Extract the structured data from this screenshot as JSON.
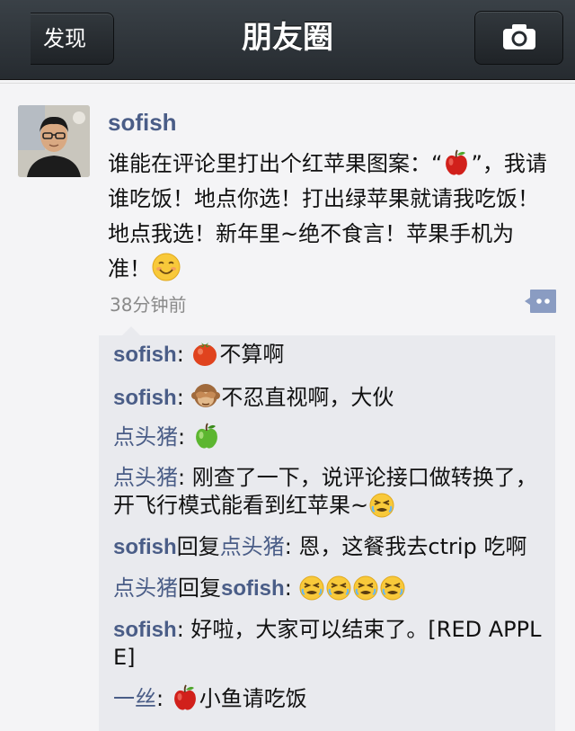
{
  "nav": {
    "back_label": "发现",
    "title": "朋友圈",
    "camera_icon": "camera-icon"
  },
  "post": {
    "author": "sofish",
    "text_before_apple": "谁能在评论里打出个红苹果图案：“",
    "text_after_apple": "”，我请谁吃饭！地点你选！打出绿苹果就请我吃饭！地点我选！新年里~绝不食言！苹果手机为准！",
    "time": "38分钟前",
    "comment_icon": "comment-bubble-icon"
  },
  "comments": [
    {
      "name": "sofish",
      "sep": ": ",
      "text": "不算啊",
      "emoji": "red-tomato-apple"
    },
    {
      "name": "sofish",
      "sep": ": ",
      "text": "不忍直视啊，大伙",
      "emoji": "see-no-evil-monkey"
    },
    {
      "name": "点头猪",
      "sep": ": ",
      "text": "",
      "emoji": "green-apple"
    },
    {
      "name": "点头猪",
      "sep": ": ",
      "text": "刚查了一下，说评论接口做转换了，开飞行模式能看到红苹果~",
      "emoji": "tired-face"
    },
    {
      "name": "sofish",
      "reply_word": "回复",
      "reply_to": "点头猪",
      "sep": ": ",
      "text": "恩，这餐我去ctrip 吃啊"
    },
    {
      "name": "点头猪",
      "reply_word": "回复",
      "reply_to": "sofish",
      "sep": ": ",
      "emoji": "tired-face-x4"
    },
    {
      "name": "sofish",
      "sep": ": ",
      "text": "好啦，大家可以结束了。[RED APPLE]"
    },
    {
      "name": "一丝",
      "sep": ": ",
      "text": "小鱼请吃饭",
      "emoji": "red-apple"
    }
  ],
  "colors": {
    "nav_bg": "#2b3035",
    "name_link": "#4a5d87",
    "comment_bg": "#e9eaee",
    "page_bg": "#f4f4f6"
  }
}
